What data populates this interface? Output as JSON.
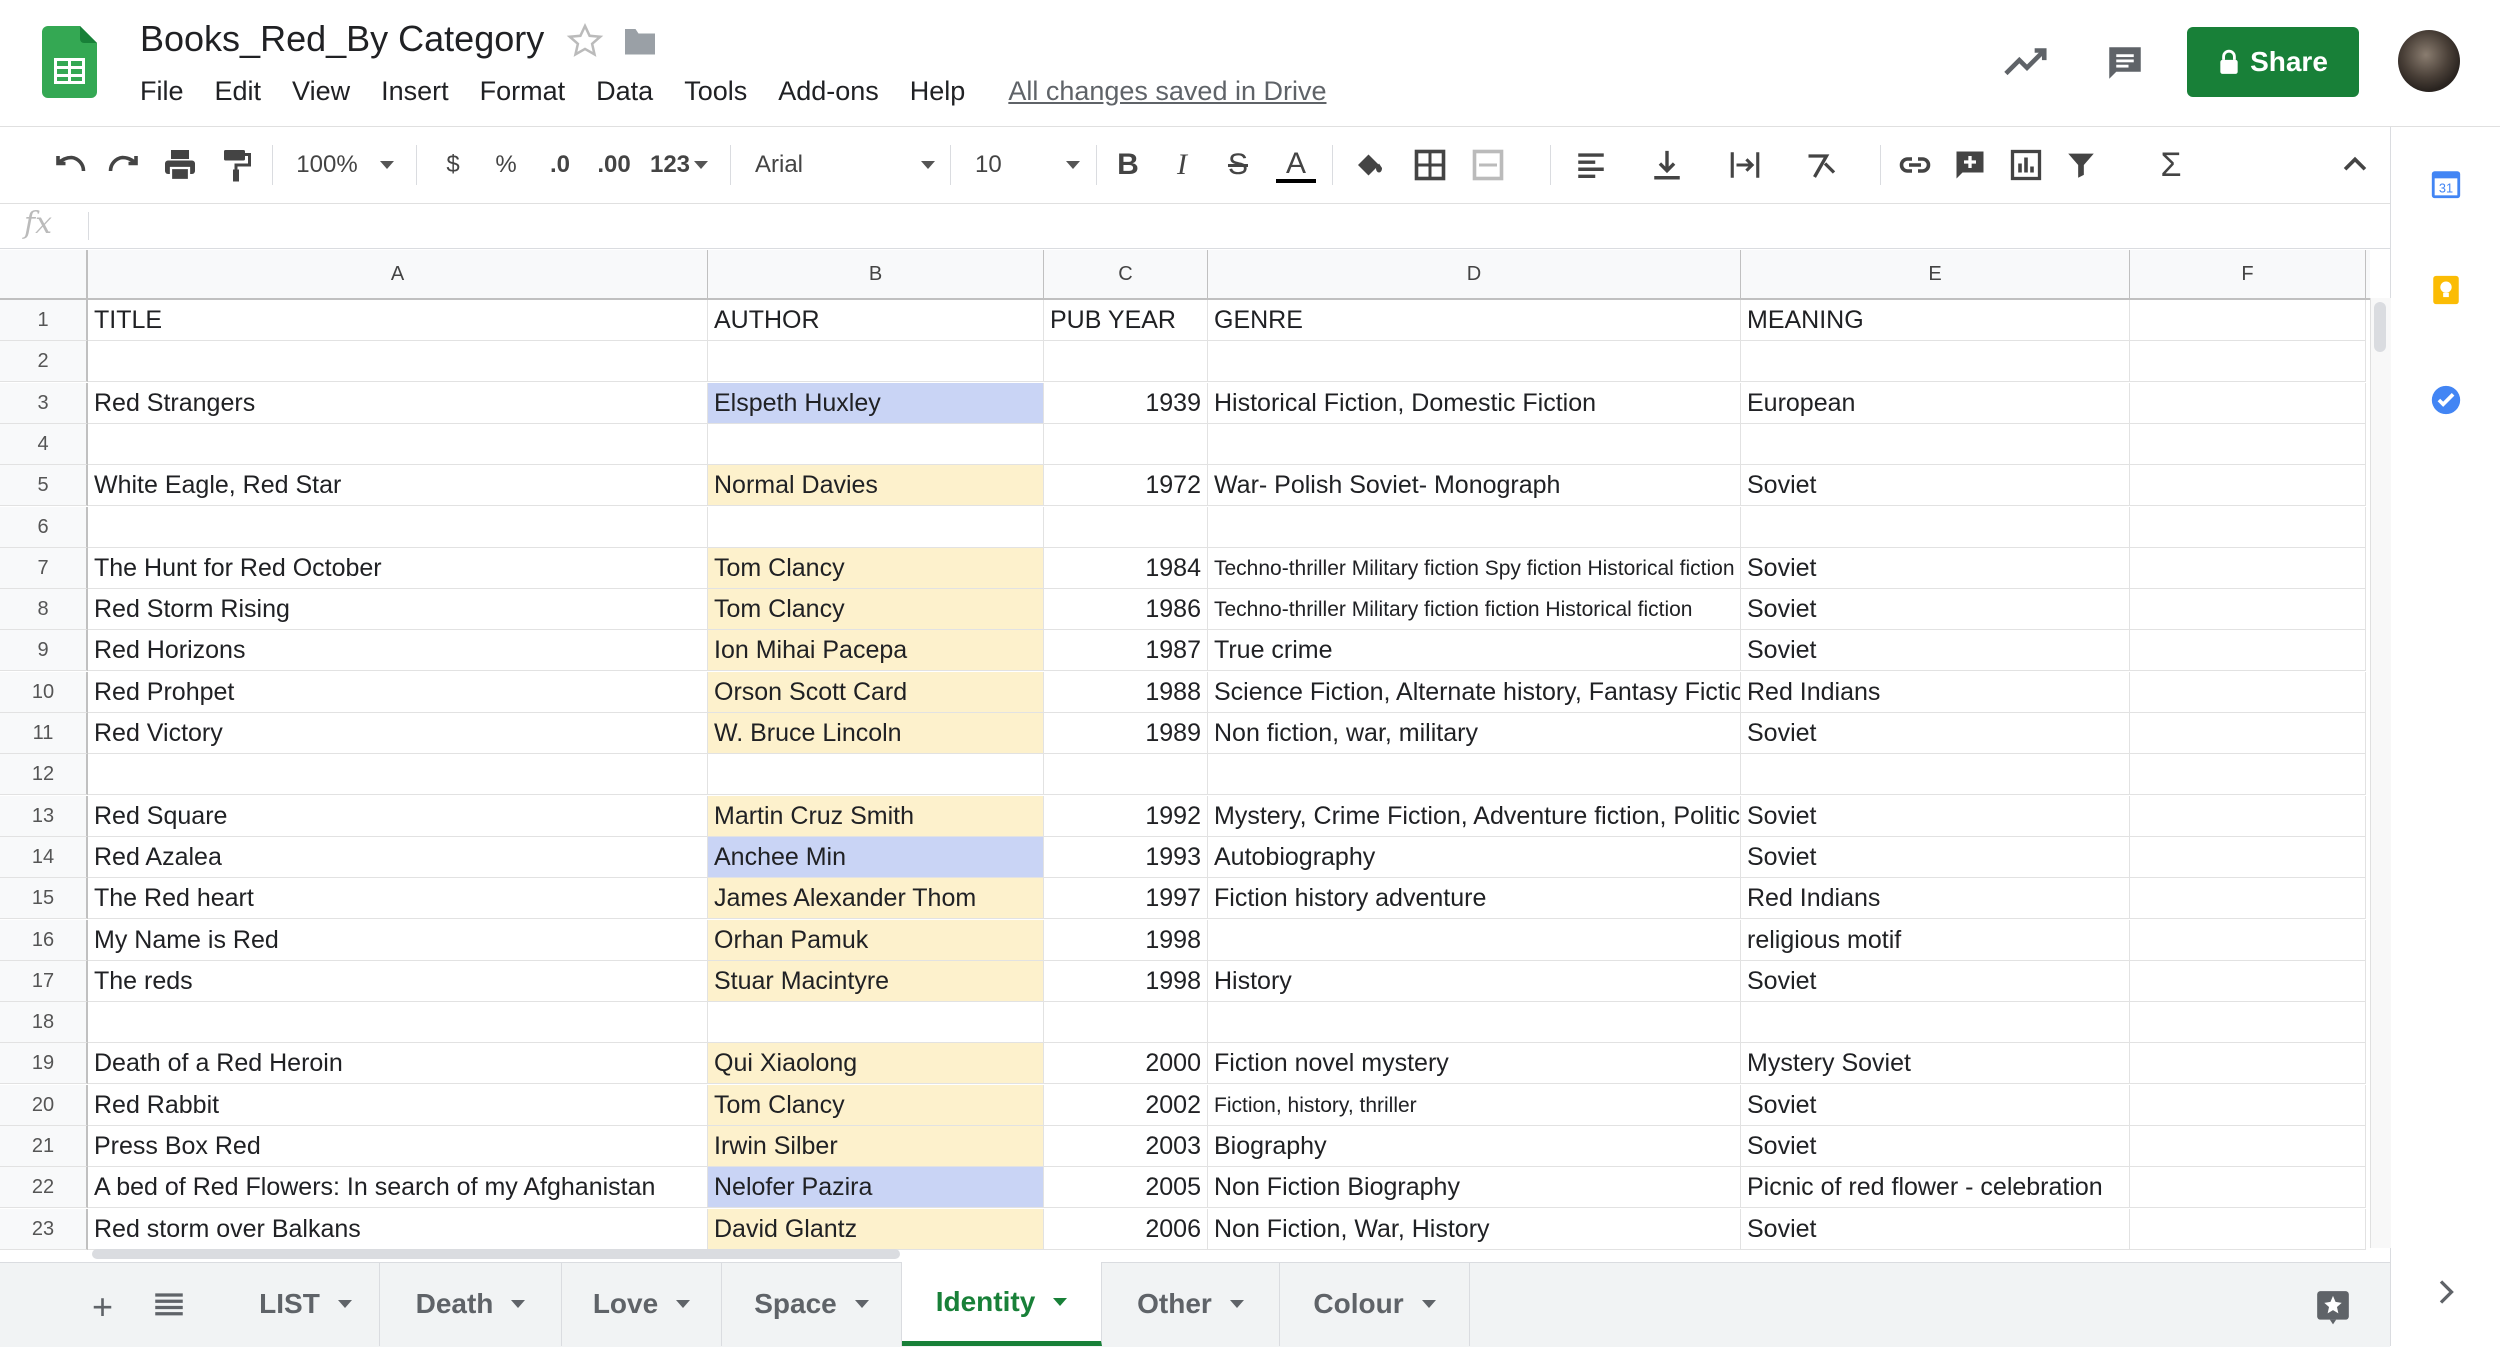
{
  "header": {
    "title": "Books_Red_By Category",
    "menu": [
      "File",
      "Edit",
      "View",
      "Insert",
      "Format",
      "Data",
      "Tools",
      "Add-ons",
      "Help"
    ],
    "saved_status": "All changes saved in Drive",
    "share_label": "Share"
  },
  "toolbar": {
    "zoom": "100%",
    "currency": "$",
    "percent": "%",
    "dec_decrease": ".0",
    "dec_increase": ".00",
    "more_formats": "123",
    "font": "Arial",
    "font_size": "10",
    "bold": "B",
    "italic": "I",
    "strike": "S",
    "text_color": "A",
    "sum": "Σ"
  },
  "formula_bar": {
    "label": "fx",
    "value": ""
  },
  "sheet": {
    "columns": [
      "A",
      "B",
      "C",
      "D",
      "E",
      "F"
    ],
    "rows": [
      {
        "n": "1",
        "cells": [
          "TITLE",
          "AUTHOR",
          "PUB YEAR",
          "GENRE",
          "MEANING",
          ""
        ],
        "fill": ""
      },
      {
        "n": "2",
        "cells": [
          "",
          "",
          "",
          "",
          "",
          ""
        ],
        "fill": ""
      },
      {
        "n": "3",
        "cells": [
          "Red Strangers",
          "Elspeth Huxley",
          "1939",
          "Historical Fiction, Domestic Fiction",
          "European",
          ""
        ],
        "fill": "blue"
      },
      {
        "n": "4",
        "cells": [
          "",
          "",
          "",
          "",
          "",
          ""
        ],
        "fill": ""
      },
      {
        "n": "5",
        "cells": [
          "White Eagle, Red Star",
          "Normal Davies",
          "1972",
          "War- Polish Soviet- Monograph",
          "Soviet",
          ""
        ],
        "fill": "yellow"
      },
      {
        "n": "6",
        "cells": [
          "",
          "",
          "",
          "",
          "",
          ""
        ],
        "fill": ""
      },
      {
        "n": "7",
        "cells": [
          "The Hunt for Red October",
          "Tom Clancy",
          "1984",
          "Techno-thriller Military fiction Spy fiction Historical fiction",
          "Soviet",
          ""
        ],
        "fill": "yellow",
        "small": true
      },
      {
        "n": "8",
        "cells": [
          "Red Storm Rising",
          "Tom Clancy",
          "1986",
          "Techno-thriller Military fiction  fiction Historical fiction",
          "Soviet",
          ""
        ],
        "fill": "yellow",
        "small": true
      },
      {
        "n": "9",
        "cells": [
          "Red Horizons",
          "Ion Mihai Pacepa",
          "1987",
          "True crime",
          "Soviet",
          ""
        ],
        "fill": "yellow"
      },
      {
        "n": "10",
        "cells": [
          "Red Prohpet",
          "Orson Scott Card",
          "1988",
          "Science Fiction, Alternate history, Fantasy Fiction",
          "Red Indians",
          ""
        ],
        "fill": "yellow"
      },
      {
        "n": "11",
        "cells": [
          "Red Victory",
          "W. Bruce Lincoln",
          "1989",
          "Non fiction, war, military",
          "Soviet",
          ""
        ],
        "fill": "yellow"
      },
      {
        "n": "12",
        "cells": [
          "",
          "",
          "",
          "",
          "",
          ""
        ],
        "fill": ""
      },
      {
        "n": "13",
        "cells": [
          "Red Square",
          "Martin Cruz Smith",
          "1992",
          "Mystery, Crime Fiction, Adventure fiction, Political",
          "Soviet",
          ""
        ],
        "fill": "yellow"
      },
      {
        "n": "14",
        "cells": [
          "Red Azalea",
          "Anchee Min",
          "1993",
          "Autobiography",
          "Soviet",
          ""
        ],
        "fill": "blue"
      },
      {
        "n": "15",
        "cells": [
          "The Red heart",
          "James Alexander Thom",
          "1997",
          "Fiction history adventure",
          "Red Indians",
          ""
        ],
        "fill": "yellow"
      },
      {
        "n": "16",
        "cells": [
          "My Name is Red",
          "Orhan Pamuk",
          "1998",
          "",
          "religious motif",
          ""
        ],
        "fill": "yellow"
      },
      {
        "n": "17",
        "cells": [
          "The reds",
          "Stuar Macintyre",
          "1998",
          "History",
          "Soviet",
          ""
        ],
        "fill": "yellow"
      },
      {
        "n": "18",
        "cells": [
          "",
          "",
          "",
          "",
          "",
          ""
        ],
        "fill": ""
      },
      {
        "n": "19",
        "cells": [
          "Death of a Red Heroin",
          "Qui Xiaolong",
          "2000",
          "Fiction novel mystery",
          "Mystery Soviet",
          ""
        ],
        "fill": "yellow"
      },
      {
        "n": "20",
        "cells": [
          "Red Rabbit",
          "Tom Clancy",
          "2002",
          "Fiction, history, thriller",
          "Soviet",
          ""
        ],
        "fill": "yellow",
        "small": true
      },
      {
        "n": "21",
        "cells": [
          "Press Box Red",
          "Irwin Silber",
          "2003",
          "Biography",
          "Soviet",
          ""
        ],
        "fill": "yellow"
      },
      {
        "n": "22",
        "cells": [
          "A bed of Red Flowers: In search of my Afghanistan",
          "Nelofer Pazira",
          "2005",
          "Non Fiction Biography",
          "Picnic of red flower - celebration",
          ""
        ],
        "fill": "blue"
      },
      {
        "n": "23",
        "cells": [
          "Red storm over Balkans",
          "David Glantz",
          "2006",
          "Non Fiction, War, History",
          "Soviet",
          ""
        ],
        "fill": "yellow"
      }
    ]
  },
  "tabs": [
    "LIST",
    "Death",
    "Love",
    "Space",
    "Identity",
    "Other",
    "Colour"
  ],
  "active_tab": "Identity",
  "colors": {
    "brand_green": "#188038",
    "fill_blue": "#c9d4f5",
    "fill_yellow": "#fdf1cc"
  }
}
